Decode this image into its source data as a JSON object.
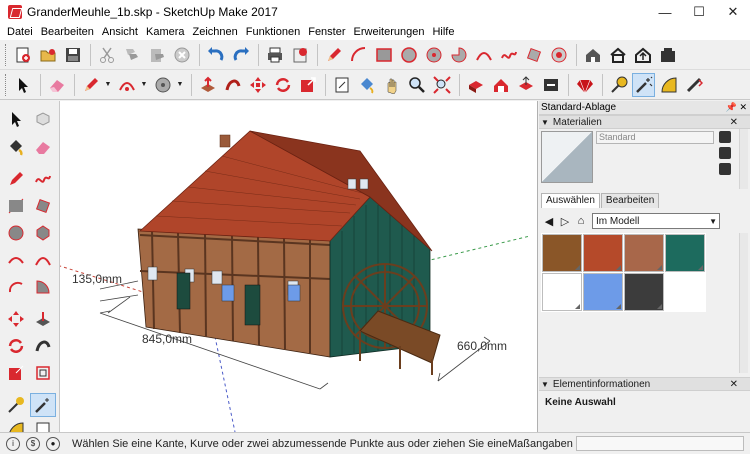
{
  "window": {
    "title": "GranderMeuhle_1b.skp - SketchUp Make 2017",
    "minimize": "—",
    "maximize": "☐",
    "close": "✕"
  },
  "menu": [
    "Datei",
    "Bearbeiten",
    "Ansicht",
    "Kamera",
    "Zeichnen",
    "Funktionen",
    "Fenster",
    "Erweiterungen",
    "Hilfe"
  ],
  "viewport": {
    "dimensions": [
      {
        "name": "height-dimension",
        "value": "135,0mm"
      },
      {
        "name": "length-dimension",
        "value": "845,0mm"
      },
      {
        "name": "depth-dimension",
        "value": "660,0mm"
      }
    ]
  },
  "tray": {
    "title": "Standard-Ablage",
    "materials": {
      "header": "Materialien",
      "current_material": "Standard",
      "tabs": [
        "Auswählen",
        "Bearbeiten"
      ],
      "collection": "Im Modell",
      "swatches": [
        {
          "name": "wood-swatch",
          "color": "#8a5628"
        },
        {
          "name": "roof-tile-swatch",
          "color": "#b54a2a"
        },
        {
          "name": "brick-swatch",
          "color": "#a8674a"
        },
        {
          "name": "green-wood-swatch",
          "color": "#1d6b5e"
        },
        {
          "name": "white-swatch",
          "color": "#ffffff"
        },
        {
          "name": "glass-swatch",
          "color": "#6d9be8"
        },
        {
          "name": "dark-swatch",
          "color": "#3c3c3c"
        }
      ]
    },
    "entity_info": {
      "header": "Elementinformationen",
      "selection": "Keine Auswahl"
    }
  },
  "status": {
    "message": "Wählen Sie eine Kante, Kurve oder zwei abzumessende Punkte aus oder ziehen Sie eine ...",
    "measurements_label": "Maßangaben",
    "measurements_value": ""
  },
  "colors": {
    "roof": "#b0452a",
    "brick": "#a36a45",
    "timber": "#5a3520",
    "green_wall": "#1f5a4e",
    "wheel": "#6b3e1e",
    "axis_red": "#c8463a",
    "axis_green": "#3a9a4a",
    "axis_blue": "#4a5ac8"
  }
}
